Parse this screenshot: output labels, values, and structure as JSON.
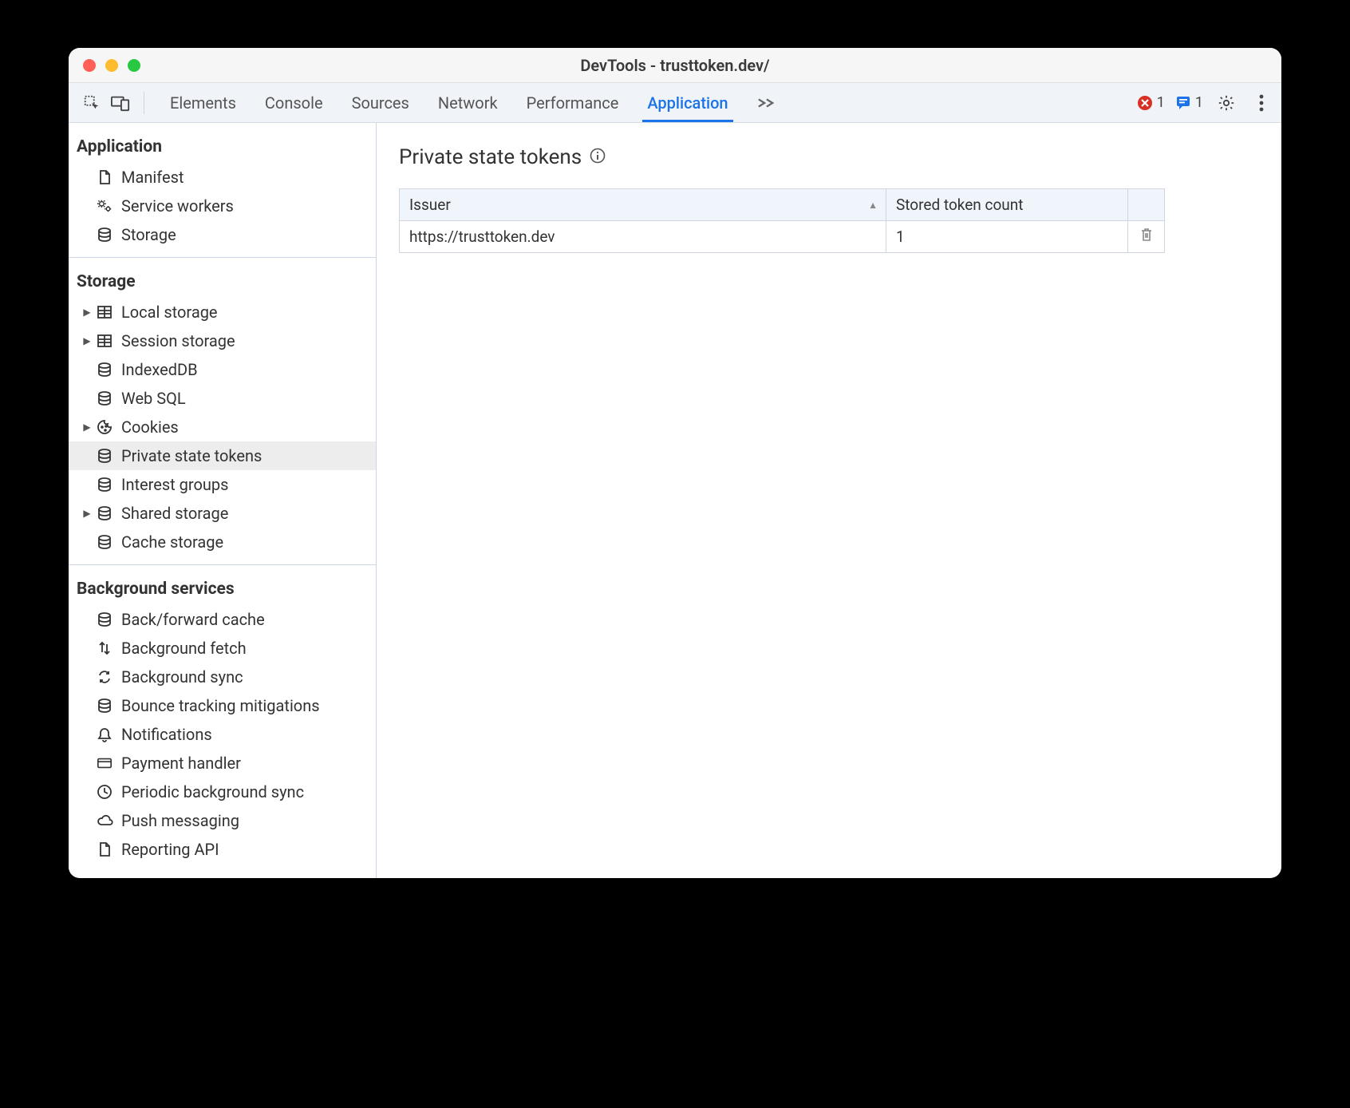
{
  "window": {
    "title": "DevTools - trusttoken.dev/"
  },
  "toolbar": {
    "tabs": [
      "Elements",
      "Console",
      "Sources",
      "Network",
      "Performance",
      "Application"
    ],
    "active": "Application",
    "error_count": "1",
    "issue_count": "1"
  },
  "sidebar": {
    "sections": [
      {
        "title": "Application",
        "items": [
          {
            "label": "Manifest",
            "icon": "file",
            "expandable": false
          },
          {
            "label": "Service workers",
            "icon": "gears",
            "expandable": false
          },
          {
            "label": "Storage",
            "icon": "db",
            "expandable": false
          }
        ]
      },
      {
        "title": "Storage",
        "items": [
          {
            "label": "Local storage",
            "icon": "table",
            "expandable": true
          },
          {
            "label": "Session storage",
            "icon": "table",
            "expandable": true
          },
          {
            "label": "IndexedDB",
            "icon": "db",
            "expandable": false
          },
          {
            "label": "Web SQL",
            "icon": "db",
            "expandable": false
          },
          {
            "label": "Cookies",
            "icon": "cookie",
            "expandable": true
          },
          {
            "label": "Private state tokens",
            "icon": "db",
            "expandable": false,
            "selected": true
          },
          {
            "label": "Interest groups",
            "icon": "db",
            "expandable": false
          },
          {
            "label": "Shared storage",
            "icon": "db",
            "expandable": true
          },
          {
            "label": "Cache storage",
            "icon": "db",
            "expandable": false
          }
        ]
      },
      {
        "title": "Background services",
        "items": [
          {
            "label": "Back/forward cache",
            "icon": "db",
            "expandable": false
          },
          {
            "label": "Background fetch",
            "icon": "arrows",
            "expandable": false
          },
          {
            "label": "Background sync",
            "icon": "sync",
            "expandable": false
          },
          {
            "label": "Bounce tracking mitigations",
            "icon": "db",
            "expandable": false
          },
          {
            "label": "Notifications",
            "icon": "bell",
            "expandable": false
          },
          {
            "label": "Payment handler",
            "icon": "card",
            "expandable": false
          },
          {
            "label": "Periodic background sync",
            "icon": "clock",
            "expandable": false
          },
          {
            "label": "Push messaging",
            "icon": "cloud",
            "expandable": false
          },
          {
            "label": "Reporting API",
            "icon": "file",
            "expandable": false
          }
        ]
      }
    ]
  },
  "main": {
    "title": "Private state tokens",
    "columns": [
      "Issuer",
      "Stored token count"
    ],
    "rows": [
      {
        "issuer": "https://trusttoken.dev",
        "count": "1"
      }
    ]
  }
}
